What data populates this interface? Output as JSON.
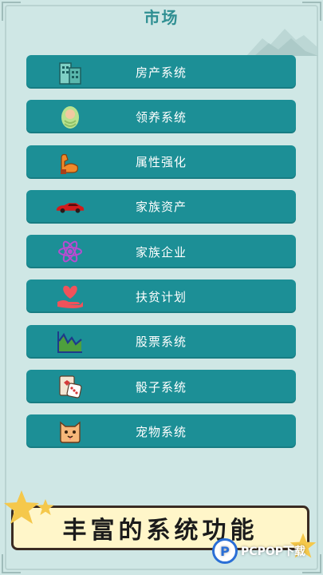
{
  "header": {
    "title": "市场"
  },
  "menu": {
    "items": [
      {
        "label": "房产系统",
        "icon": "building-icon"
      },
      {
        "label": "领养系统",
        "icon": "baby-icon"
      },
      {
        "label": "属性强化",
        "icon": "muscle-arm-icon"
      },
      {
        "label": "家族资产",
        "icon": "car-icon"
      },
      {
        "label": "家族企业",
        "icon": "atom-icon"
      },
      {
        "label": "扶贫计划",
        "icon": "heart-hand-icon"
      },
      {
        "label": "股票系统",
        "icon": "stock-chart-icon"
      },
      {
        "label": "骰子系统",
        "icon": "dice-icon"
      },
      {
        "label": "宠物系统",
        "icon": "pet-icon"
      }
    ]
  },
  "banner": {
    "text": "丰富的系统功能"
  },
  "watermark": {
    "text": "PCPOP下载"
  },
  "colors": {
    "background": "#cfe7e5",
    "button": "#1c8f96",
    "title": "#2f8f92",
    "banner": "#fff6c9",
    "star": "#f5c84b"
  }
}
